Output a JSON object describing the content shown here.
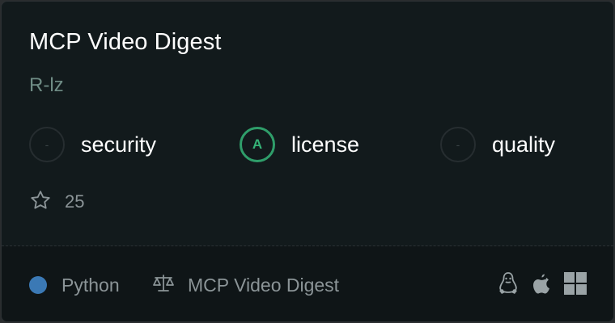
{
  "card": {
    "title": "MCP Video Digest",
    "author": "R-lz",
    "scores": [
      {
        "grade": "-",
        "label": "security"
      },
      {
        "grade": "A",
        "label": "license"
      },
      {
        "grade": "-",
        "label": "quality"
      }
    ],
    "stars": {
      "icon": "star-icon",
      "count": "25"
    },
    "footer": {
      "language": {
        "name": "Python",
        "color": "#3b79b5"
      },
      "license": {
        "icon": "scale-icon",
        "name": "MCP Video Digest"
      },
      "platforms": [
        "linux-icon",
        "apple-icon",
        "windows-icon"
      ]
    }
  },
  "colors": {
    "background": "#121a1c",
    "footer": "#0f1517",
    "grade_a": "#2f9e6a",
    "author": "#6f8c85"
  }
}
